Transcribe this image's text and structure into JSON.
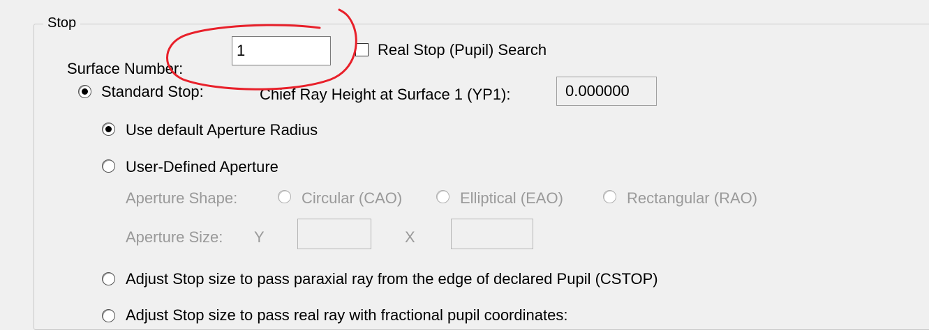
{
  "stop_group": {
    "title": "Stop",
    "surface_number_label": "Surface Number:",
    "surface_number_value": "1",
    "real_stop_search_label": "Real Stop (Pupil) Search",
    "real_stop_search_checked": false,
    "standard_stop_label": "Standard Stop:",
    "standard_stop_checked": true,
    "chief_ray_label": "Chief Ray Height at Surface 1 (YP1):",
    "chief_ray_value": "0.000000",
    "use_default_aperture_label": "Use default Aperture Radius",
    "use_default_aperture_checked": true,
    "user_defined_aperture_label": "User-Defined Aperture",
    "user_defined_aperture_checked": false,
    "aperture_shape_label": "Aperture Shape:",
    "aperture_shape_options": [
      "Circular (CAO)",
      "Elliptical (EAO)",
      "Rectangular (RAO)"
    ],
    "aperture_size_label": "Aperture Size:",
    "aperture_size_y_label": "Y",
    "aperture_size_x_label": "X",
    "aperture_size_y_value": "",
    "aperture_size_x_value": "",
    "cstop_label": "Adjust Stop size to pass paraxial ray from the edge of declared Pupil (CSTOP)",
    "real_ray_label": "Adjust Stop size to pass real ray with fractional pupil coordinates:"
  },
  "annotation": {
    "color": "#e8202a",
    "shape": "hand-drawn circle around Surface Number field"
  }
}
